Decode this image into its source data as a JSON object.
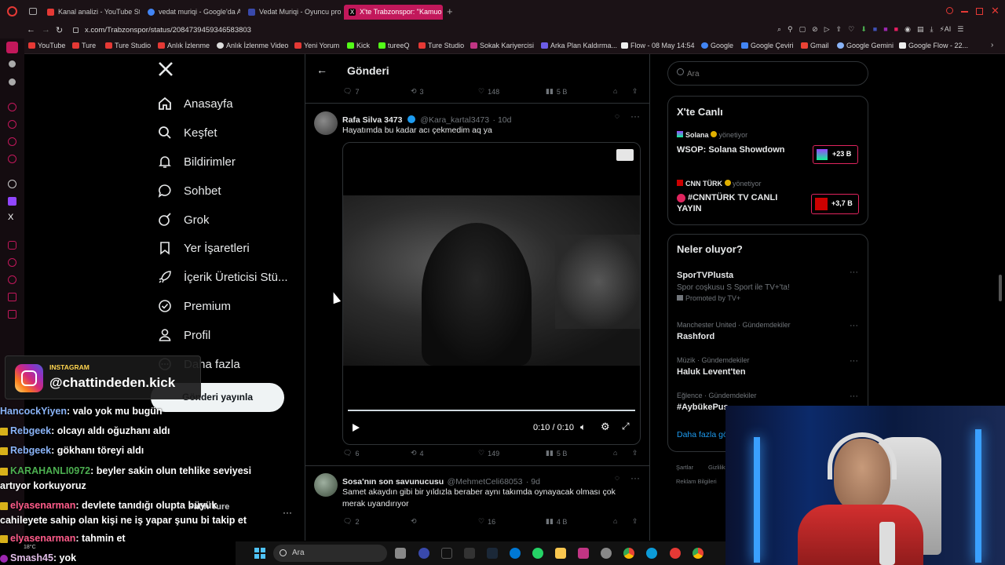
{
  "browser": {
    "tabs": [
      {
        "label": "Kanal analizi - YouTube Stu",
        "color": "#e53935"
      },
      {
        "label": "vedat muriqi - Google'da A",
        "color": "#4285f4"
      },
      {
        "label": "Vedat Muriqi - Oyuncu pro",
        "color": "#3949ab"
      },
      {
        "label": "X'te Trabzonspor: \"Kamuo",
        "color": "#000000"
      }
    ],
    "url": "x.com/Trabzonspor/status/2084739459346583803",
    "bookmarks": [
      "YouTube",
      "Ture",
      "Ture Studio",
      "Anlık İzlenme",
      "Anlık İzlenme Video",
      "Yeni Yorum",
      "Kick",
      "tureeQ",
      "Ture Studio",
      "Sokak Kariyercisi",
      "Arka Plan Kaldırma...",
      "Flow - 08 May 14:54",
      "Google",
      "Google Çeviri",
      "Gmail",
      "Google Gemini",
      "Google Flow - 22..."
    ]
  },
  "sidebar": {
    "logo": "X",
    "items": [
      {
        "label": "Anasayfa",
        "icon": "home-icon"
      },
      {
        "label": "Keşfet",
        "icon": "search-icon"
      },
      {
        "label": "Bildirimler",
        "icon": "bell-icon"
      },
      {
        "label": "Sohbet",
        "icon": "chat-icon"
      },
      {
        "label": "Grok",
        "icon": "grok-icon"
      },
      {
        "label": "Yer İşaretleri",
        "icon": "bookmark-icon"
      },
      {
        "label": "İçerik Üreticisi Stü...",
        "icon": "rocket-icon"
      },
      {
        "label": "Premium",
        "icon": "verified-icon"
      },
      {
        "label": "Profil",
        "icon": "person-icon"
      },
      {
        "label": "Daha fazla",
        "icon": "more-icon"
      }
    ],
    "post_button": "Gönderi yayınla"
  },
  "center": {
    "header": "Gönderi",
    "top_actions": {
      "replies": "7",
      "reposts": "3",
      "likes": "148",
      "views": "5 B"
    },
    "post1": {
      "name": "Rafa Silva 3473",
      "handle": "@Kara_kartal3473",
      "time": "· 10d",
      "text": "Hayatımda bu kadar acı çekmedim aq ya",
      "video_time": "0:10 / 0:10",
      "actions": {
        "replies": "6",
        "reposts": "4",
        "likes": "149",
        "views": "5 B"
      }
    },
    "post2": {
      "name": "Sosa'nın son savunucusu",
      "handle": "@MehmetCeli68053",
      "time": "· 9d",
      "text": "Samet akaydın gibi bir yıldızla beraber aynı takımda oynayacak olması çok merak uyandırıyor",
      "actions": {
        "replies": "2",
        "reposts": "",
        "likes": "16",
        "views": "4 B"
      }
    }
  },
  "right": {
    "search_placeholder": "Ara",
    "live": {
      "title": "X'te Canlı",
      "items": [
        {
          "host": "Solana",
          "role": "yönetiyor",
          "title": "WSOP: Solana Showdown",
          "count": "+23 B"
        },
        {
          "host": "CNN TÜRK",
          "role": "yönetiyor",
          "title": "#CNNTÜRK TV CANLI YAYIN",
          "count": "+3,7 B"
        }
      ]
    },
    "trends": {
      "title": "Neler oluyor?",
      "promo": {
        "name": "SporTVPlusta",
        "text": "Spor coşkusu S Sport ile TV+'ta!",
        "promoted": "Promoted by TV+"
      },
      "items": [
        {
          "category": "Manchester United · Gündemdekiler",
          "name": "Rashford"
        },
        {
          "category": "Müzik · Gündemdekiler",
          "name": "Haluk Levent'ten"
        },
        {
          "category": "Eğlence · Gündemdekiler",
          "name": "#AybükePus"
        }
      ],
      "show_more": "Daha fazla gö"
    },
    "footer": [
      "Şartlar",
      "Gizlilik",
      "Reklam Bilgileri"
    ]
  },
  "overlay": {
    "instagram_label": "INSTAGRAM",
    "instagram_handle": "@chattindeden.kick",
    "chat": [
      {
        "user": "HancockYiyen",
        "msg": "valo yok mu bugün"
      },
      {
        "user": "Rebgeek",
        "msg": "olcayı aldı oğuzhanı aldı"
      },
      {
        "user": "Rebgeek",
        "msg": "gökhanı töreyi aldı"
      },
      {
        "user": "KARAHANLI0972",
        "msg": "beyler sakin olun tehlike seviyesi artıyor korkuyoruz"
      },
      {
        "user": "elyasenarman",
        "msg": "devlete tanıdığı olupta büyük cahileyete sahip olan kişi ne iş yapar şunu bi takip et"
      },
      {
        "user": "elyasenarman",
        "msg": "tahmin et"
      },
      {
        "user": "Smash45",
        "msg": "yok"
      }
    ],
    "account_name": "Fatih Ture"
  },
  "taskbar": {
    "search_placeholder": "Ara",
    "weather": "18°C"
  }
}
